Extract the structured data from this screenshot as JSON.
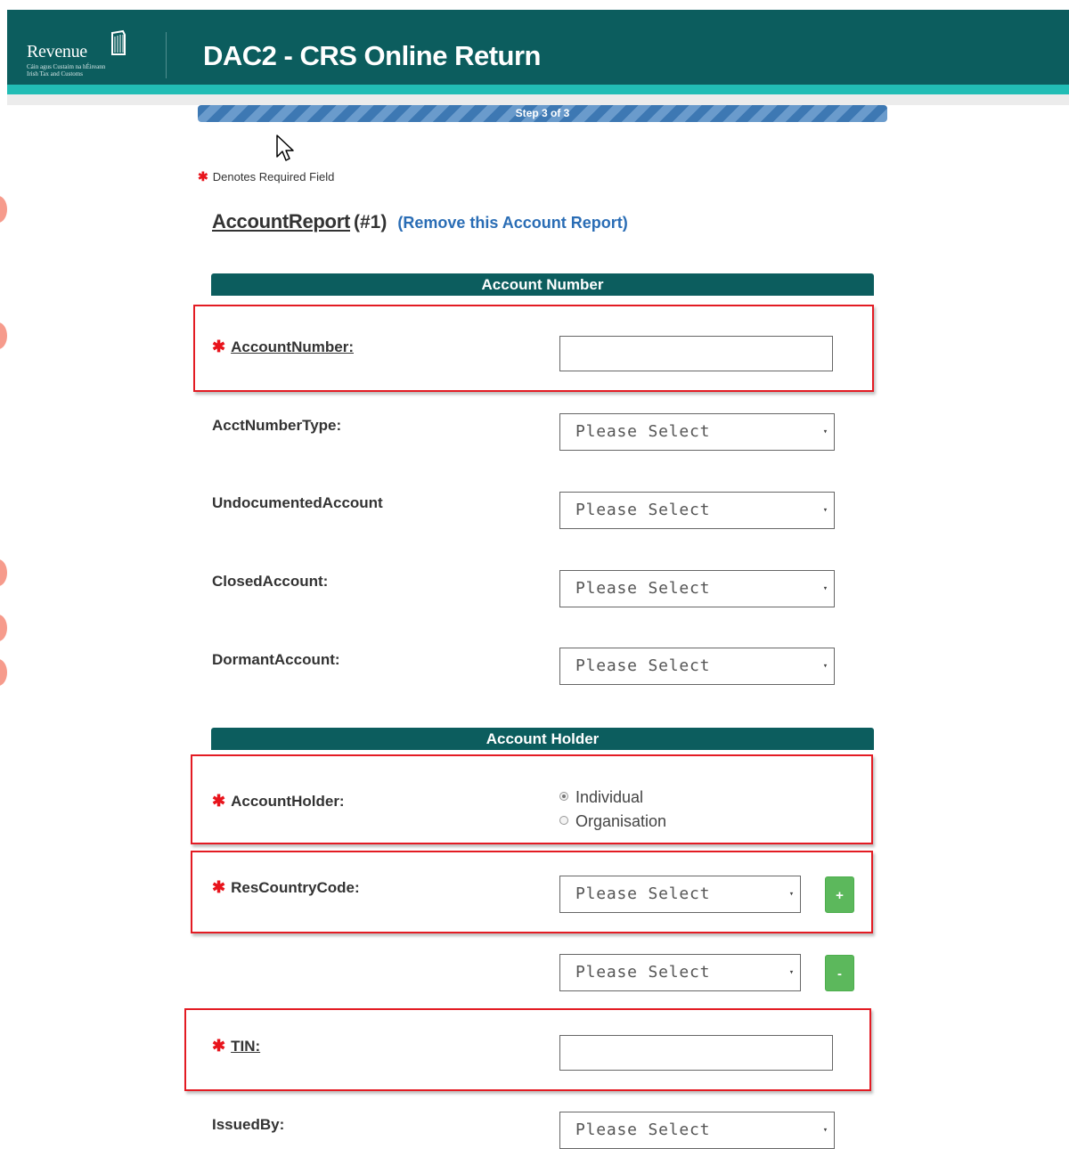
{
  "header": {
    "logo_word": "Revenue",
    "logo_sub1": "Cáin agus Custaim na hÉireann",
    "logo_sub2": "Irish Tax and Customs",
    "title": "DAC2 - CRS Online Return",
    "colors": {
      "header_bg": "#0c5d5e",
      "stripe": "#22bdb5"
    }
  },
  "progress": {
    "label": "Step 3 of 3",
    "current_step": 3,
    "total_steps": 3
  },
  "required_note": {
    "star": "✱",
    "text": "Denotes Required Field"
  },
  "report": {
    "link": "AccountReport",
    "number": "(#1)",
    "remove": "(Remove this Account Report)"
  },
  "sections": {
    "account_number": "Account Number",
    "account_holder": "Account Holder"
  },
  "fields": {
    "account_number": {
      "label": "AccountNumber:",
      "value": ""
    },
    "acct_number_type": {
      "label": "AcctNumberType:",
      "value": "Please Select"
    },
    "undocumented_account": {
      "label": "UndocumentedAccount",
      "value": "Please Select"
    },
    "closed_account": {
      "label": "ClosedAccount:",
      "value": "Please Select"
    },
    "dormant_account": {
      "label": "DormantAccount:",
      "value": "Please Select"
    },
    "account_holder": {
      "label": "AccountHolder:",
      "options": [
        "Individual",
        "Organisation"
      ],
      "selected": "Individual"
    },
    "res_country_code": {
      "label": "ResCountryCode:",
      "value_1": "Please Select",
      "value_2": "Please Select",
      "add_label": "+",
      "remove_label": "-"
    },
    "tin": {
      "label": "TIN:",
      "value": ""
    },
    "issued_by": {
      "label": "IssuedBy:",
      "value": "Please Select"
    }
  },
  "icons": {
    "select_arrow": "▾",
    "harp": "harp-icon",
    "cursor": "mouse-pointer-icon"
  },
  "accent_colors": {
    "required": "#e8141c",
    "highlight": "#e31b23",
    "link": "#2a6db5",
    "add_button": "#5cb85c"
  }
}
